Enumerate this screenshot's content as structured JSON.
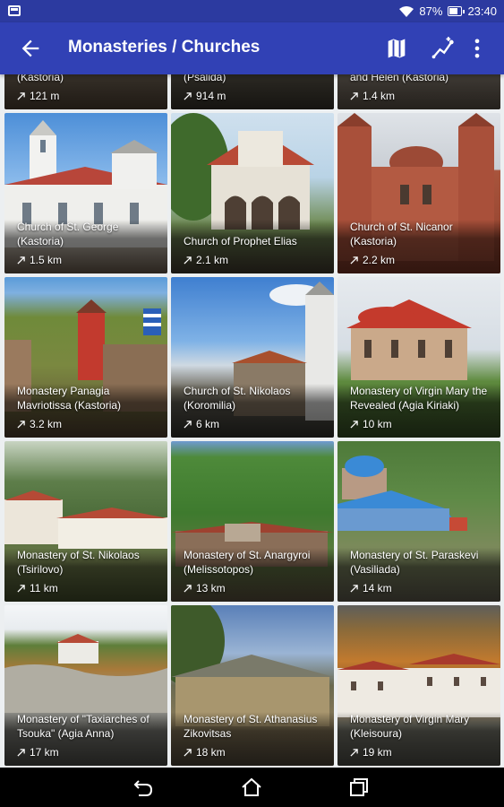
{
  "status": {
    "battery": "87%",
    "time": "23:40"
  },
  "toolbar": {
    "title": "Monasteries / Churches"
  },
  "tiles": [
    {
      "name": "(Kastoria)",
      "distance": "121 m"
    },
    {
      "name": "(Psalida)",
      "distance": "914 m"
    },
    {
      "name": "and Helen (Kastoria)",
      "distance": "1.4 km"
    },
    {
      "name": "Church of St. George (Kastoria)",
      "distance": "1.5 km"
    },
    {
      "name": "Church of Prophet Elias",
      "distance": "2.1 km"
    },
    {
      "name": "Church of St. Nicanor (Kastoria)",
      "distance": "2.2 km"
    },
    {
      "name": "Monastery Panagia Mavriotissa (Kastoria)",
      "distance": "3.2 km"
    },
    {
      "name": "Church of St. Nikolaos (Koromilia)",
      "distance": "6 km"
    },
    {
      "name": "Monastery of Virgin Mary the Revealed (Agia Kiriaki)",
      "distance": "10 km"
    },
    {
      "name": "Monastery of St. Nikolaos (Tsirilovo)",
      "distance": "11 km"
    },
    {
      "name": "Monastery of St. Anargyroi (Melissotopos)",
      "distance": "13 km"
    },
    {
      "name": "Monastery of St. Paraskevi (Vasiliada)",
      "distance": "14 km"
    },
    {
      "name": "Monastery of \"Taxiarches of Tsouka\" (Agia Anna)",
      "distance": "17 km"
    },
    {
      "name": "Monastery of St. Athanasius Zikovitsas",
      "distance": "18 km"
    },
    {
      "name": "Monastery of  Virgin Mary (Kleisoura)",
      "distance": "19 km"
    }
  ],
  "icons": {
    "back": "arrow-left-icon",
    "map": "map-icon",
    "route": "route-icon",
    "more": "more-vert-icon",
    "distance": "north-east-arrow-icon",
    "nav_back": "nav-back-icon",
    "nav_home": "nav-home-icon",
    "nav_recents": "nav-recents-icon"
  },
  "colors": {
    "status_bar": "#2c3aa0",
    "app_bar": "#3141b5",
    "background": "#eceff1"
  }
}
